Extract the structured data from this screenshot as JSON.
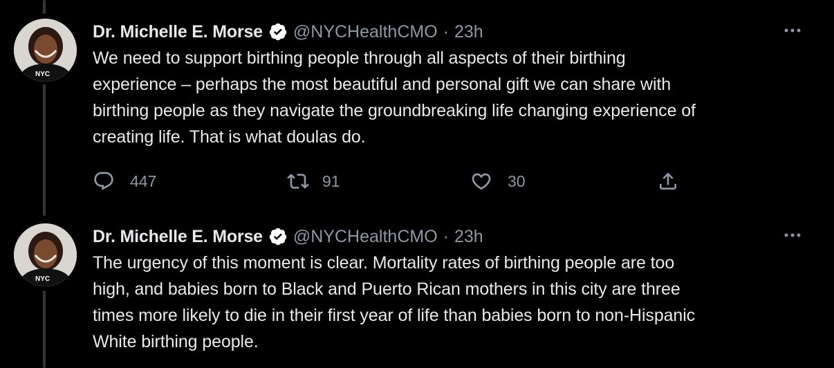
{
  "tweets": [
    {
      "author": {
        "name": "Dr. Michelle E. Morse",
        "handle": "@NYCHealthCMO",
        "avatar_badge": "NYC",
        "verified_icon": "verified-badge-icon"
      },
      "separator": "·",
      "time": "23h",
      "more_icon": "more-horizontal-icon",
      "lines": [
        "We need to support birthing people through all aspects of their birthing",
        "experience – perhaps the most beautiful and personal gift we can share with",
        "birthing people as they navigate the groundbreaking life changing experience of",
        "creating life. That is what doulas do."
      ],
      "actions": {
        "reply_icon": "reply-icon",
        "replies": "447",
        "retweet_icon": "retweet-icon",
        "retweets": "91",
        "like_icon": "heart-icon",
        "likes": "30",
        "share_icon": "share-icon"
      }
    },
    {
      "author": {
        "name": "Dr. Michelle E. Morse",
        "handle": "@NYCHealthCMO",
        "avatar_badge": "NYC",
        "verified_icon": "verified-badge-icon"
      },
      "separator": "·",
      "time": "23h",
      "more_icon": "more-horizontal-icon",
      "lines": [
        "The urgency of this moment is clear. Mortality rates of birthing people are too",
        "high, and babies born to Black and Puerto Rican mothers in this city are three",
        "times more likely to die in their first year of life than babies born to non-Hispanic",
        "White birthing people."
      ]
    }
  ],
  "colors": {
    "background": "#000000",
    "text": "#e7e9ea",
    "secondary": "#8b98a5",
    "thread_line": "#333639"
  }
}
